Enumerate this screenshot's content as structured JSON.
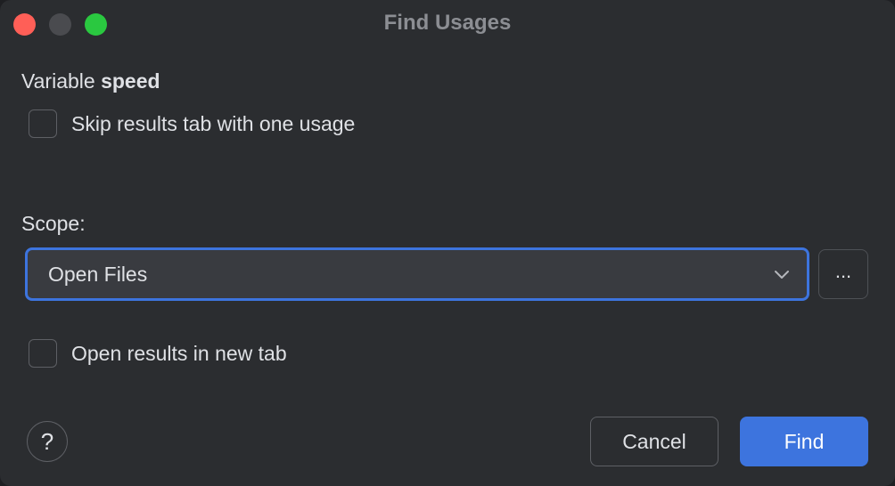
{
  "window": {
    "title": "Find Usages"
  },
  "target": {
    "kind": "Variable",
    "name": "speed"
  },
  "options": {
    "skip_results_tab": {
      "label": "Skip results tab with one usage",
      "checked": false
    },
    "open_in_new_tab": {
      "label": "Open results in new tab",
      "checked": false
    }
  },
  "scope": {
    "label": "Scope:",
    "selected": "Open Files",
    "more_label": "..."
  },
  "buttons": {
    "help": "?",
    "cancel": "Cancel",
    "find": "Find"
  },
  "icons": {
    "close": "traffic-light-close-icon",
    "minimize": "traffic-light-minimize-icon",
    "zoom": "traffic-light-zoom-icon",
    "chevron": "chevron-down-icon"
  },
  "colors": {
    "background": "#2b2d30",
    "accent": "#3d74de",
    "close": "#ff5f57",
    "zoom": "#2ac840"
  }
}
